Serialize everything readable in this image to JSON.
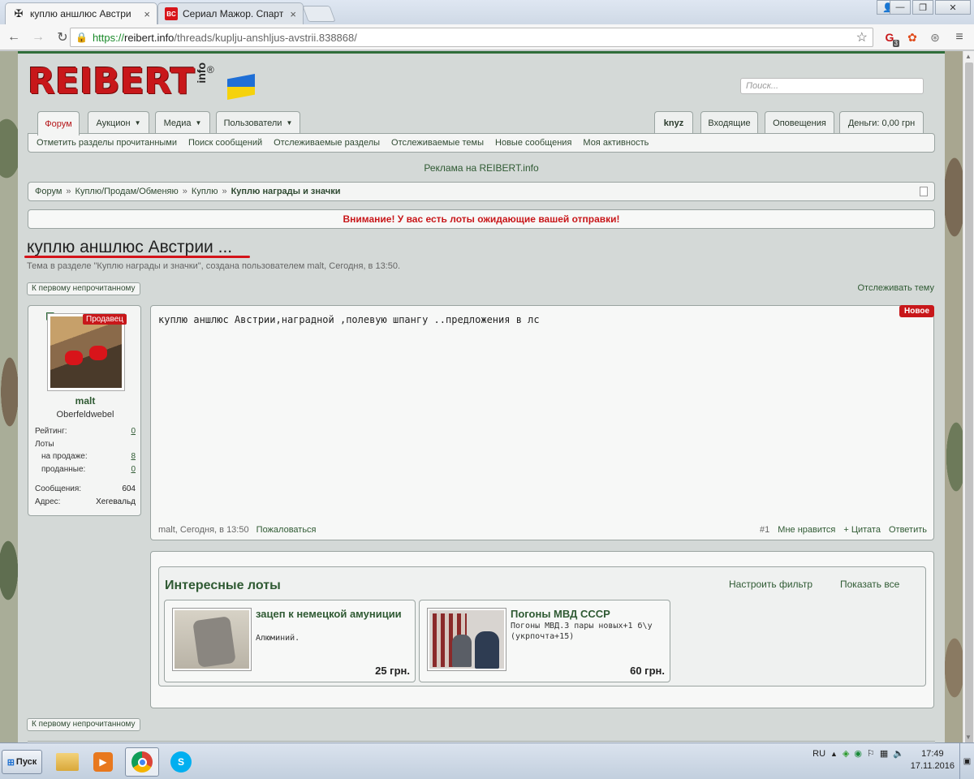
{
  "browser": {
    "tabs": [
      {
        "title": "куплю аншлюс Австрии",
        "favicon": "iron-cross-icon",
        "active": true
      },
      {
        "title": "Сериал Мажор. Спарта",
        "favicon": "bc-favicon",
        "active": false
      }
    ],
    "url": {
      "scheme": "https://",
      "host": "reibert.info",
      "path": "/threads/kuplju-anshljus-avstrii.838868/"
    },
    "ext_badge": "3"
  },
  "site": {
    "logo_text": "REIBERT",
    "logo_sub": "info",
    "logo_reg": "®",
    "search_placeholder": "Поиск...",
    "nav_tabs": [
      {
        "label": "Форум",
        "active": true,
        "chevron": false
      },
      {
        "label": "Аукцион",
        "chevron": true
      },
      {
        "label": "Медиа",
        "chevron": true
      },
      {
        "label": "Пользователи",
        "chevron": true
      }
    ],
    "account_tabs": [
      "knyz",
      "Входящие",
      "Оповещения",
      "Деньги: 0,00 грн"
    ],
    "sub_nav": [
      "Отметить разделы прочитанными",
      "Поиск сообщений",
      "Отслеживаемые разделы",
      "Отслеживаемые темы",
      "Новые сообщения",
      "Моя активность"
    ],
    "ad_text": "Реклама на REIBERT.info",
    "breadcrumbs": [
      "Форум",
      "Куплю/Продам/Обменяю",
      "Куплю",
      "Куплю награды и значки"
    ],
    "alert": "Внимание! У вас есть лоты ожидающие вашей отправки!"
  },
  "thread": {
    "title": "куплю аншлюс Австрии ...",
    "meta": "Тема в разделе \"Куплю награды и значки\", создана пользователем malt, Сегодня, в 13:50.",
    "first_unread": "К первому непрочитанному",
    "watch": "Отслеживать тему"
  },
  "author": {
    "badge": "Продавец",
    "name": "malt",
    "rank": "Oberfeldwebel",
    "stats": {
      "rating_label": "Рейтинг:",
      "rating": "0",
      "lots_label": "Лоты",
      "on_sale_label": "на продаже:",
      "on_sale": "8",
      "sold_label": "проданные:",
      "sold": "0",
      "messages_label": "Сообщения:",
      "messages": "604",
      "address_label": "Адрес:",
      "address": "Хегевальд"
    }
  },
  "post": {
    "text": "куплю аншлюс Австрии,наградной ,полевую шпангу ..предложения в лс",
    "new_badge": "Новое",
    "footer_meta": "malt, Сегодня, в 13:50",
    "report": "Пожаловаться",
    "number": "#1",
    "like": "Мне нравится",
    "quote": "+ Цитата",
    "reply": "Ответить"
  },
  "lots": {
    "title": "Интересные лоты",
    "filter": "Настроить фильтр",
    "show_all": "Показать все",
    "items": [
      {
        "name": "зацеп к немецкой амуниции",
        "desc": "Алюминий.",
        "price": "25 грн."
      },
      {
        "name": "Погоны МВД СССР",
        "desc": "Погоны МВД.3 пары новых+1 б\\у (укрпочта+15)",
        "price": "60 грн."
      }
    ]
  },
  "taskbar": {
    "start": "Пуск",
    "lang": "RU",
    "time": "17:49",
    "date": "17.11.2016"
  }
}
